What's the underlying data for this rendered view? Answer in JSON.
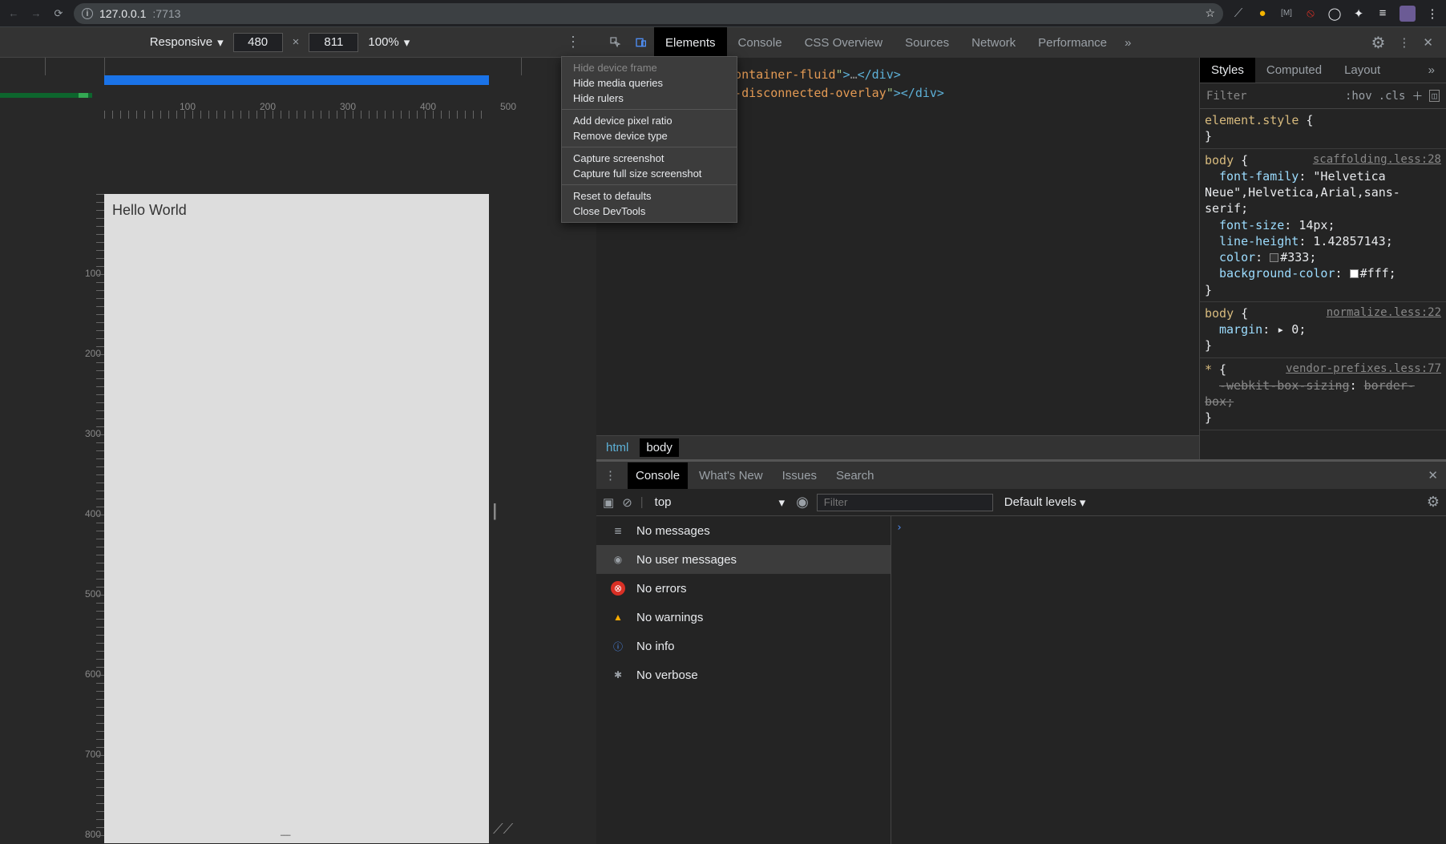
{
  "browser": {
    "url_host": "127.0.0.1",
    "url_port": ":7713"
  },
  "device_bar": {
    "device": "Responsive",
    "width": "480",
    "height": "811",
    "zoom": "100%"
  },
  "viewport": {
    "content": "Hello World",
    "h_ruler_labels": [
      "100",
      "200",
      "300",
      "400",
      "500"
    ],
    "v_ruler_labels": [
      "100",
      "200",
      "300",
      "400",
      "500",
      "600",
      "700",
      "800"
    ]
  },
  "context_menu": {
    "g1": [
      "Hide device frame",
      "Hide media queries",
      "Hide rulers"
    ],
    "g2": [
      "Add device pixel ratio",
      "Remove device type"
    ],
    "g3": [
      "Capture screenshot",
      "Capture full size screenshot"
    ],
    "g4": [
      "Reset to defaults",
      "Close DevTools"
    ],
    "disabled": "Hide device frame"
  },
  "devtools": {
    "tabs": [
      "Elements",
      "Console",
      "CSS Overview",
      "Sources",
      "Network",
      "Performance"
    ],
    "active_tab": "Elements"
  },
  "dom": {
    "line1_class": "container-fluid",
    "line2_class": "ny-disconnected-overlay",
    "breadcrumb": [
      "html",
      "body"
    ],
    "breadcrumb_active": "body"
  },
  "styles": {
    "tabs": [
      "Styles",
      "Computed",
      "Layout"
    ],
    "active": "Styles",
    "filter_placeholder": "Filter",
    "hov": ":hov",
    "cls": ".cls",
    "rules": [
      {
        "selector": "element.style",
        "src": "",
        "props": []
      },
      {
        "selector": "body",
        "src": "scaffolding.less:28",
        "props": [
          {
            "k": "font-family",
            "v": "\"Helvetica Neue\",Helvetica,Arial,sans-serif"
          },
          {
            "k": "font-size",
            "v": "14px"
          },
          {
            "k": "line-height",
            "v": "1.42857143"
          },
          {
            "k": "color",
            "v": "#333",
            "swatch": "#333"
          },
          {
            "k": "background-color",
            "v": "#fff",
            "swatch": "#fff"
          }
        ]
      },
      {
        "selector": "body",
        "src": "normalize.less:22",
        "props": [
          {
            "k": "margin",
            "v": "▸ 0"
          }
        ]
      },
      {
        "selector": "*",
        "src": "vendor-prefixes.less:77",
        "props": [
          {
            "k": "-webkit-box-sizing",
            "v": "border-box",
            "strike": true
          }
        ]
      }
    ]
  },
  "drawer": {
    "tabs": [
      "Console",
      "What's New",
      "Issues",
      "Search"
    ],
    "active": "Console",
    "context": "top",
    "filter_placeholder": "Filter",
    "levels": "Default levels",
    "sidebar": [
      {
        "icon": "list",
        "label": "No messages"
      },
      {
        "icon": "user",
        "label": "No user messages",
        "sel": true
      },
      {
        "icon": "error",
        "label": "No errors"
      },
      {
        "icon": "warn",
        "label": "No warnings"
      },
      {
        "icon": "info",
        "label": "No info"
      },
      {
        "icon": "bug",
        "label": "No verbose"
      }
    ],
    "prompt": "›"
  }
}
